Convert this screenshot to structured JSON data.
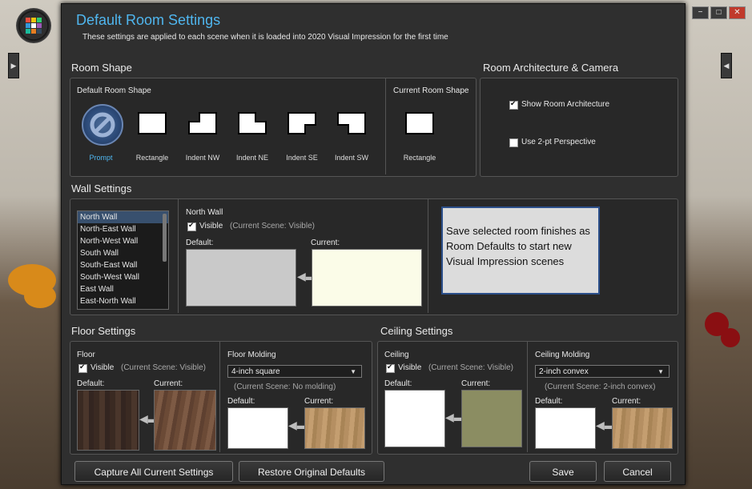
{
  "dialog": {
    "title": "Default Room Settings",
    "subtitle": "These settings are applied to each scene when it is loaded into 2020 Visual Impression for the first time"
  },
  "room_shape": {
    "heading": "Room Shape",
    "default_label": "Default Room Shape",
    "current_label": "Current Room Shape",
    "shapes": [
      "Prompt",
      "Rectangle",
      "Indent NW",
      "Indent NE",
      "Indent SE",
      "Indent SW"
    ],
    "selected": "Prompt",
    "current_shape": "Rectangle"
  },
  "architecture": {
    "heading": "Room Architecture & Camera",
    "show_architecture": {
      "label": "Show Room Architecture",
      "checked": true
    },
    "perspective": {
      "label": "Use 2-pt Perspective",
      "checked": false
    }
  },
  "wall": {
    "heading": "Wall Settings",
    "walls": [
      "North Wall",
      "North-East Wall",
      "North-West Wall",
      "South Wall",
      "South-East Wall",
      "South-West Wall",
      "East Wall",
      "East-North Wall"
    ],
    "selected": "North Wall",
    "panel_title": "North Wall",
    "visible_label": "Visible",
    "visible_status": "(Current Scene: Visible)",
    "default_label": "Default:",
    "current_label": "Current:",
    "default_color": "#c9c9c9",
    "current_color": "#fbfce8",
    "tooltip": "Save selected room finishes as Room Defaults to start new Visual Impression scenes"
  },
  "floor": {
    "heading": "Floor Settings",
    "title": "Floor",
    "visible_label": "Visible",
    "visible_status": "(Current Scene: Visible)",
    "default_label": "Default:",
    "current_label": "Current:",
    "molding_title": "Floor Molding",
    "molding_value": "4-inch square",
    "molding_status": "(Current Scene: No molding)",
    "molding_default_label": "Default:",
    "molding_current_label": "Current:"
  },
  "ceiling": {
    "heading": "Ceiling Settings",
    "title": "Ceiling",
    "visible_label": "Visible",
    "visible_status": "(Current Scene: Visible)",
    "default_label": "Default:",
    "current_label": "Current:",
    "current_color": "#8b8d62",
    "molding_title": "Ceiling Molding",
    "molding_value": "2-inch convex",
    "molding_status": "(Current Scene: 2-inch convex)",
    "molding_default_label": "Default:",
    "molding_current_label": "Current:"
  },
  "buttons": {
    "capture": "Capture All Current Settings",
    "restore": "Restore Original Defaults",
    "save": "Save",
    "cancel": "Cancel"
  },
  "colors": {
    "accent": "#4fb6ef",
    "tooltip_border": "#2b4f8a"
  }
}
